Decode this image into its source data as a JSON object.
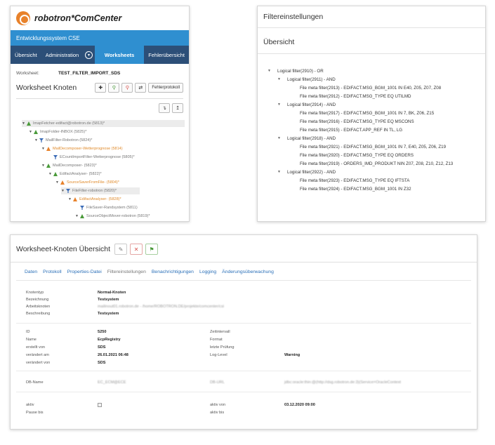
{
  "panel1": {
    "brand": "robotron*ComCenter",
    "system": "Entwicklungssystem CSE",
    "nav": [
      "Übersicht",
      "Administration",
      "Worksheets",
      "Fehlerübersicht"
    ],
    "worksheet_label": "Worksheet:",
    "worksheet_value": "TEST_FILTER_IMPORT_SDS",
    "section_title": "Worksheet Knoten",
    "fehlerprotokoll": "Fehlerprotokoll",
    "tree": [
      "ImapFetcher-edifact@robotron.de (5813)*",
      "ImapFolder-INBOX (5825)*",
      "MailFilter-Robotron (5824)*",
      "MailDecomposer-Wetterprognose (5814)",
      "ECountImportFilter-Wetterprognose (5805)*",
      "MailDecomposer- (5823)*",
      "EdifactAnalyser- (5822)*",
      "SourceSaverFromFile- (5804)*",
      "FileFilter-robotron (5820)*",
      "EdifactAnalyser- (5828)*",
      "FileSaver-Randsystem (5811)",
      "SourceObjectMover-robotron (5819)*"
    ]
  },
  "panel2": {
    "title": "Filtereinstellungen",
    "subtitle": "Übersicht",
    "filters": [
      "Logical filter(2910) - OR",
      "Logical filter(2911) - AND",
      "File meta filter(2913) - EDIFACT.MSG_BGM_1001 IN E40, Z05, Z07, Z08",
      "File meta filter(2912) - EDIFACT.MSG_TYPE EQ UTILMD",
      "Logical filter(2914) - AND",
      "File meta filter(2917) - EDIFACT.MSG_BGM_1001 IN 7, BK, Z06, Z15",
      "File meta filter(2916) - EDIFACT.MSG_TYPE EQ MSCONS",
      "File meta filter(2915) - EDIFACT.APP_REF IN TL, LG",
      "Logical filter(2918) - AND",
      "File meta filter(2921) - EDIFACT.MSG_BGM_1001 IN 7, E40, Z05, Z06, Z19",
      "File meta filter(2920) - EDIFACT.MSG_TYPE EQ ORDERS",
      "File meta filter(2919) - ORDERS_IMD_PRODUKT NIN Z07, Z08, Z10, Z12, Z13",
      "Logical filter(2922) - AND",
      "File meta filter(2923) - EDIFACT.MSG_TYPE EQ IFTSTA",
      "File meta filter(2924) - EDIFACT.MSG_BGM_1001 IN Z32"
    ]
  },
  "panel3": {
    "title": "Worksheet-Knoten Übersicht",
    "tabs": [
      "Daten",
      "Protokoll",
      "Properties-Datei",
      "Filtereinstellungen",
      "Benachrichtigungen",
      "Logging",
      "Änderungsüberwachung"
    ],
    "rows1": [
      {
        "label": "Knotentyp",
        "value": "Normal-Knoten"
      },
      {
        "label": "Bezeichnung",
        "value": "Testsystem"
      },
      {
        "label": "Arbeitsknoten",
        "value": "mailinout01.robotron.de - /home/ROBOTRON.DE/projekte/comcenter/csi"
      },
      {
        "label": "Beschreibung",
        "value": "Testsystem"
      }
    ],
    "rows2": [
      {
        "label": "ID",
        "value": "5250"
      },
      {
        "label": "Name",
        "value": "EcpRegistry"
      },
      {
        "label": "erstellt von",
        "value": "SDS"
      },
      {
        "label": "verändert am",
        "value": "26.01.2021 06:48"
      },
      {
        "label": "verändert von",
        "value": "SDS"
      }
    ],
    "rows2_right": [
      {
        "label": "Zeitintervall",
        "value": ""
      },
      {
        "label": "Format",
        "value": ""
      },
      {
        "label": "letzte Prüfung",
        "value": ""
      },
      {
        "label": "Log-Level",
        "value": "Warning"
      }
    ],
    "db_label": "DB-Name",
    "db_value": "EC_ECM@ECE",
    "db_url_label": "DB-URL",
    "db_url_value": "jdbc:oracle:thin:@(http://dsg.robotron.de:3)(Service=OracleContext",
    "aktiv_label": "aktiv",
    "pause_label": "Pause bis",
    "aktiv_von_label": "aktiv von",
    "aktiv_von_value": "03.12.2020 09:00",
    "aktiv_bis_label": "aktiv bis"
  }
}
